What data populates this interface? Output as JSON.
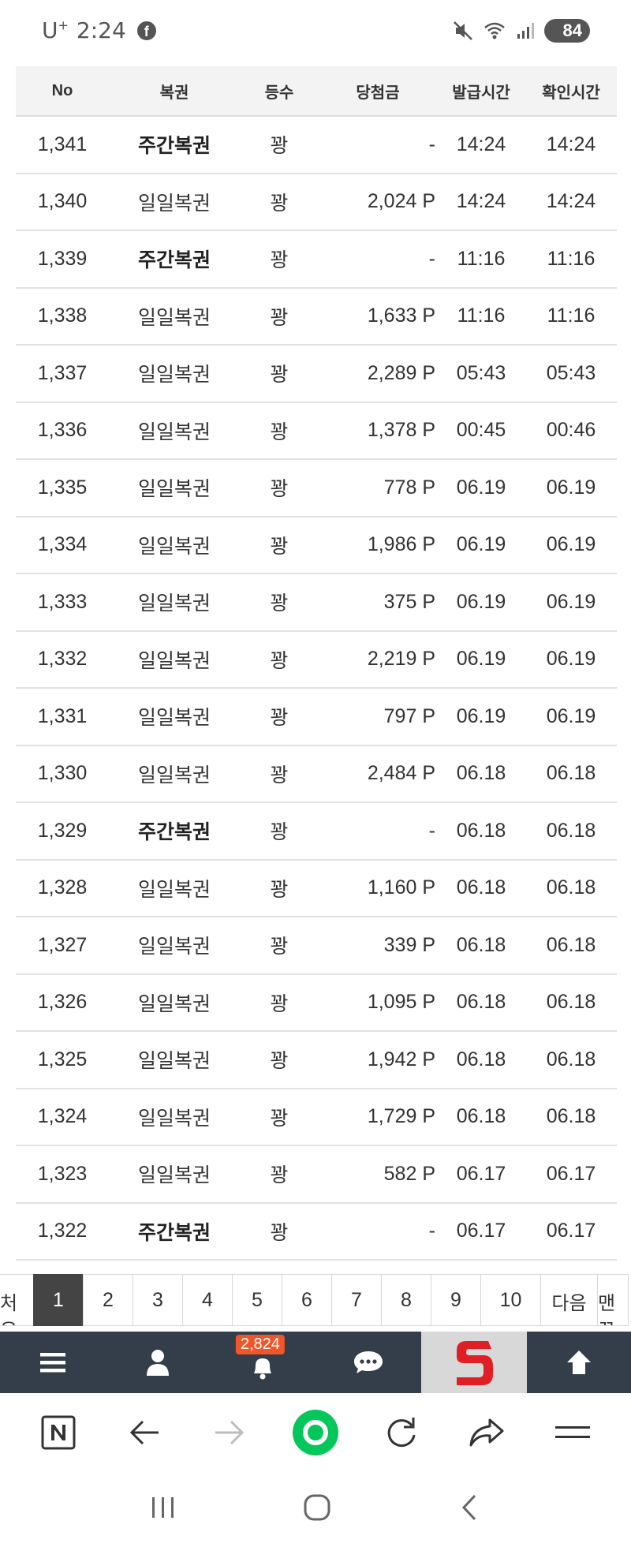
{
  "status_bar": {
    "carrier": "U",
    "carrier_plus": "+",
    "time": "2:24",
    "battery": "84"
  },
  "table": {
    "headers": [
      "No",
      "복권",
      "등수",
      "당첨금",
      "발급시간",
      "확인시간"
    ],
    "rows": [
      {
        "no": "1,341",
        "lottery": "주간복권",
        "rank": "꽝",
        "prize": "-",
        "issued": "14:24",
        "checked": "14:24",
        "bold": true
      },
      {
        "no": "1,340",
        "lottery": "일일복권",
        "rank": "꽝",
        "prize": "2,024 P",
        "issued": "14:24",
        "checked": "14:24",
        "bold": false
      },
      {
        "no": "1,339",
        "lottery": "주간복권",
        "rank": "꽝",
        "prize": "-",
        "issued": "11:16",
        "checked": "11:16",
        "bold": true
      },
      {
        "no": "1,338",
        "lottery": "일일복권",
        "rank": "꽝",
        "prize": "1,633 P",
        "issued": "11:16",
        "checked": "11:16",
        "bold": false
      },
      {
        "no": "1,337",
        "lottery": "일일복권",
        "rank": "꽝",
        "prize": "2,289 P",
        "issued": "05:43",
        "checked": "05:43",
        "bold": false
      },
      {
        "no": "1,336",
        "lottery": "일일복권",
        "rank": "꽝",
        "prize": "1,378 P",
        "issued": "00:45",
        "checked": "00:46",
        "bold": false
      },
      {
        "no": "1,335",
        "lottery": "일일복권",
        "rank": "꽝",
        "prize": "778 P",
        "issued": "06.19",
        "checked": "06.19",
        "bold": false
      },
      {
        "no": "1,334",
        "lottery": "일일복권",
        "rank": "꽝",
        "prize": "1,986 P",
        "issued": "06.19",
        "checked": "06.19",
        "bold": false
      },
      {
        "no": "1,333",
        "lottery": "일일복권",
        "rank": "꽝",
        "prize": "375 P",
        "issued": "06.19",
        "checked": "06.19",
        "bold": false
      },
      {
        "no": "1,332",
        "lottery": "일일복권",
        "rank": "꽝",
        "prize": "2,219 P",
        "issued": "06.19",
        "checked": "06.19",
        "bold": false
      },
      {
        "no": "1,331",
        "lottery": "일일복권",
        "rank": "꽝",
        "prize": "797 P",
        "issued": "06.19",
        "checked": "06.19",
        "bold": false
      },
      {
        "no": "1,330",
        "lottery": "일일복권",
        "rank": "꽝",
        "prize": "2,484 P",
        "issued": "06.18",
        "checked": "06.18",
        "bold": false
      },
      {
        "no": "1,329",
        "lottery": "주간복권",
        "rank": "꽝",
        "prize": "-",
        "issued": "06.18",
        "checked": "06.18",
        "bold": true
      },
      {
        "no": "1,328",
        "lottery": "일일복권",
        "rank": "꽝",
        "prize": "1,160 P",
        "issued": "06.18",
        "checked": "06.18",
        "bold": false
      },
      {
        "no": "1,327",
        "lottery": "일일복권",
        "rank": "꽝",
        "prize": "339 P",
        "issued": "06.18",
        "checked": "06.18",
        "bold": false
      },
      {
        "no": "1,326",
        "lottery": "일일복권",
        "rank": "꽝",
        "prize": "1,095 P",
        "issued": "06.18",
        "checked": "06.18",
        "bold": false
      },
      {
        "no": "1,325",
        "lottery": "일일복권",
        "rank": "꽝",
        "prize": "1,942 P",
        "issued": "06.18",
        "checked": "06.18",
        "bold": false
      },
      {
        "no": "1,324",
        "lottery": "일일복권",
        "rank": "꽝",
        "prize": "1,729 P",
        "issued": "06.18",
        "checked": "06.18",
        "bold": false
      },
      {
        "no": "1,323",
        "lottery": "일일복권",
        "rank": "꽝",
        "prize": "582 P",
        "issued": "06.17",
        "checked": "06.17",
        "bold": false
      },
      {
        "no": "1,322",
        "lottery": "주간복권",
        "rank": "꽝",
        "prize": "-",
        "issued": "06.17",
        "checked": "06.17",
        "bold": true
      }
    ]
  },
  "pagination": {
    "first_label": "처음",
    "pages": [
      "1",
      "2",
      "3",
      "4",
      "5",
      "6",
      "7",
      "8",
      "9",
      "10"
    ],
    "active": "1",
    "next_label": "다음",
    "last_label": "맨끝"
  },
  "app_bar": {
    "notification_count": "2,824",
    "icons": [
      "menu-icon",
      "user-icon",
      "bell-icon",
      "chat-icon",
      "site-logo",
      "arrow-up-icon"
    ]
  },
  "browser_bar": {
    "icons": [
      "naver-icon",
      "back-icon",
      "forward-icon",
      "home-green-icon",
      "refresh-icon",
      "share-icon",
      "menu-lines-icon"
    ]
  },
  "colors": {
    "app_bar_bg": "#333e4a",
    "badge_bg": "#f0562a",
    "active_page_bg": "#444444",
    "naver_green": "#03c75a",
    "logo_red": "#e01e25"
  }
}
